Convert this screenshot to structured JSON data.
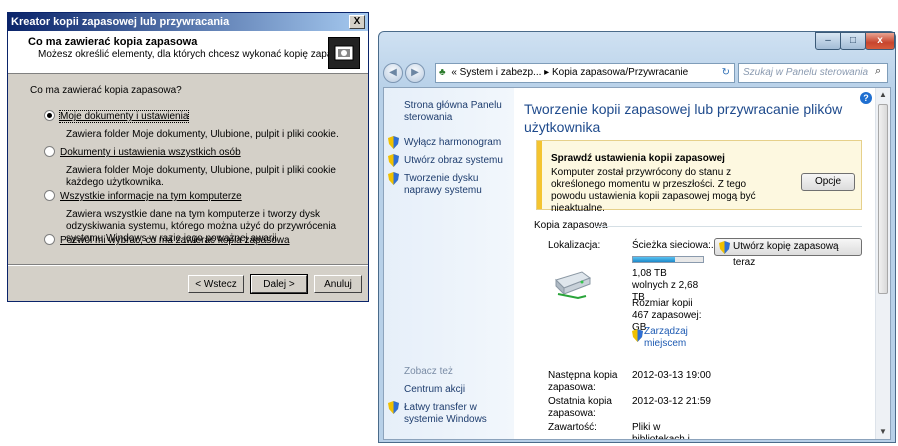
{
  "wizard": {
    "title": "Kreator kopii zapasowej lub przywracania",
    "close": "X",
    "header_title": "Co ma zawierać kopia zapasowa",
    "header_subtitle": "Możesz określić elementy, dla których chcesz wykonać kopię zapasową.",
    "question": "Co ma zawierać kopia zapasowa?",
    "options": [
      {
        "label": "Moje dokumenty i ustawienia",
        "desc": "Zawiera folder Moje dokumenty, Ulubione, pulpit i pliki cookie.",
        "selected": true
      },
      {
        "label": "Dokumenty i ustawienia wszystkich osób",
        "desc": "Zawiera folder Moje dokumenty, Ulubione, pulpit i pliki cookie każdego użytkownika.",
        "selected": false
      },
      {
        "label": "Wszystkie informacje na tym komputerze",
        "desc": "Zawiera wszystkie dane na tym komputerze i tworzy dysk odzyskiwania systemu, którego można użyć do przywrócenia systemu Windows w razie jego poważnej awarii.",
        "selected": false
      },
      {
        "label": "Pozwól mi wybrać, co ma zawierać kopia zapasowa",
        "desc": "",
        "selected": false
      }
    ],
    "buttons": {
      "back": "< Wstecz",
      "next": "Dalej >",
      "cancel": "Anuluj"
    }
  },
  "win7": {
    "controls": {
      "minimize": "–",
      "maximize": "□",
      "close": "x"
    },
    "breadcrumb": [
      "« System i zabezp...",
      "Kopia zapasowa/Przywracanie"
    ],
    "search_placeholder": "Szukaj w Panelu sterowania",
    "sidebar": {
      "home": "Strona główna Panelu sterowania",
      "links": [
        "Wyłącz harmonogram",
        "Utwórz obraz systemu",
        "Tworzenie dysku naprawy systemu"
      ],
      "see_also": "Zobacz też",
      "see_also_links": [
        "Centrum akcji",
        "Łatwy transfer w systemie Windows"
      ]
    },
    "main": {
      "title": "Tworzenie kopii zapasowej lub przywracanie plików użytkownika",
      "warning_title": "Sprawdź ustawienia kopii zapasowej",
      "warning_body": "Komputer został przywrócony do stanu z określonego momentu w przeszłości. Z tego powodu ustawienia kopii zapasowej mogą być nieaktualne.",
      "options_button": "Opcje",
      "section": "Kopia zapasowa",
      "location_label": "Lokalizacja:",
      "location_value": "Ścieżka sieciowa:...",
      "backup_now_button": "Utwórz kopię zapasową teraz",
      "free_space": "1,08 TB wolnych z 2,68 TB",
      "free_fraction": 0.6,
      "backup_size": "Rozmiar kopii 467 zapasowej: GB",
      "manage_space": "Zarządzaj miejscem",
      "next_label": "Następna kopia zapasowa:",
      "next_value": "2012-03-13 19:00",
      "last_label": "Ostatnia kopia zapasowa:",
      "last_value": "2012-03-12 21:59",
      "contents_label": "Zawartość:",
      "contents_value": "Pliki w bibliotekach i"
    }
  }
}
